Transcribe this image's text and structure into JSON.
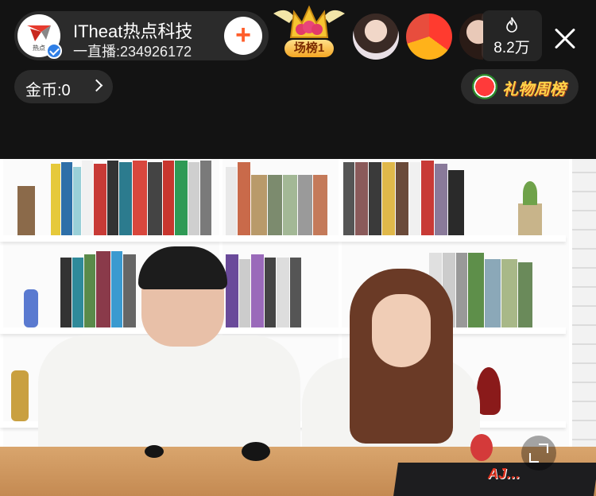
{
  "host": {
    "name": "ITheat热点科技",
    "room_line": "一直播:234926172",
    "avatar_caption": "热点",
    "follow_symbol": "+"
  },
  "rank_badge": {
    "label": "场榜1"
  },
  "viewers": {
    "count": "8.2万",
    "icon": "flame-icon"
  },
  "coins": {
    "label": "金币:0"
  },
  "gift_weekly": {
    "label": "礼物周榜",
    "icon": "watermelon-icon"
  },
  "watermark": {
    "text": "AJ…"
  },
  "colors": {
    "accent_orange": "#ff5e2b",
    "verified_blue": "#2f7fe6",
    "gold": "#ffd54a",
    "dark_bg": "#131313"
  }
}
